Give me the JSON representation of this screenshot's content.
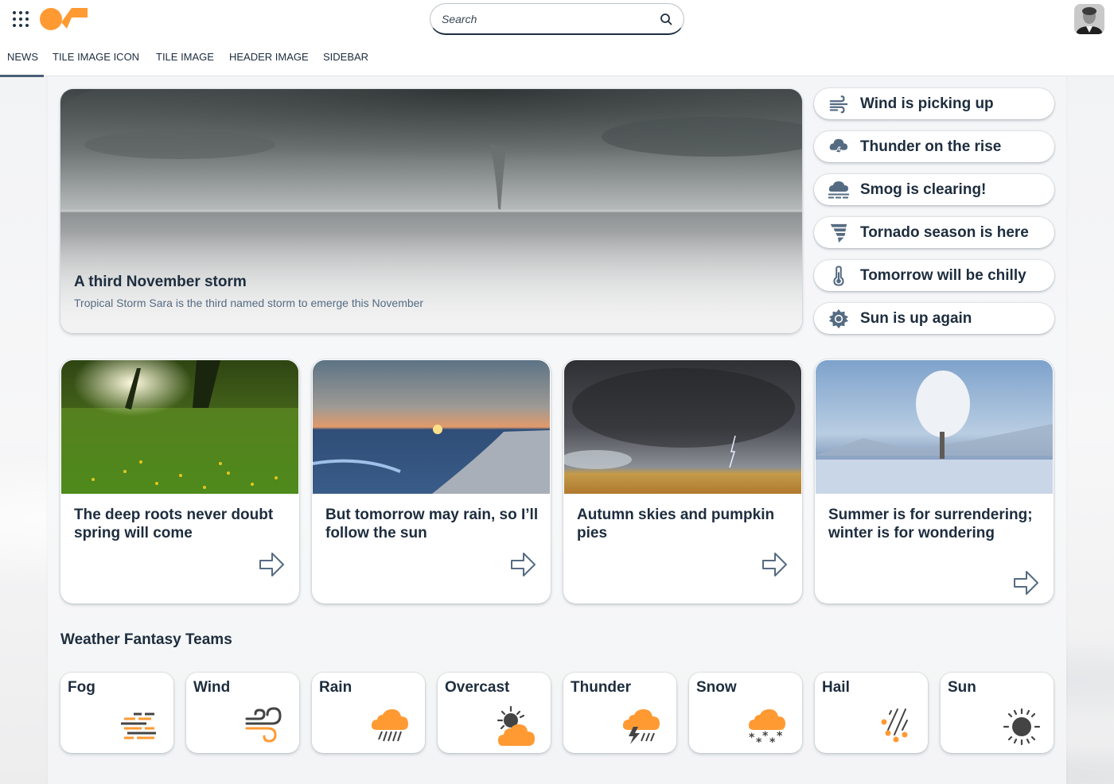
{
  "header": {
    "apps_icon": "grid-dots-icon",
    "logo": "brand-logo",
    "search": {
      "placeholder": "Search",
      "value": "",
      "icon": "search-icon"
    },
    "avatar": "user-avatar"
  },
  "tabs": [
    {
      "label": "NEWS",
      "active": true
    },
    {
      "label": "TILE IMAGE ICON",
      "active": false
    },
    {
      "label": "TILE IMAGE",
      "active": false
    },
    {
      "label": "HEADER IMAGE",
      "active": false
    },
    {
      "label": "SIDEBAR",
      "active": false
    }
  ],
  "hero": {
    "title": "A third November storm",
    "subtitle": "Tropical Storm Sara is the third named storm to emerge this November",
    "image": "tornado-over-sea"
  },
  "side_list": [
    {
      "label": "Wind is picking up",
      "icon": "wind-icon"
    },
    {
      "label": "Thunder on the rise",
      "icon": "thunder-cloud-icon"
    },
    {
      "label": "Smog is clearing!",
      "icon": "smog-icon"
    },
    {
      "label": "Tornado season is here",
      "icon": "tornado-icon"
    },
    {
      "label": "Tomorrow will be chilly",
      "icon": "thermometer-icon"
    },
    {
      "label": "Sun is up again",
      "icon": "sun-gear-icon"
    }
  ],
  "cards": [
    {
      "title": "The deep roots never doubt spring will come",
      "image": "spring-meadow",
      "action": "arrow-right-icon"
    },
    {
      "title": "But tomorrow may rain, so I’ll follow the sun",
      "image": "beach-sunset",
      "action": "arrow-right-icon"
    },
    {
      "title": "Autumn skies and pumpkin pies",
      "image": "storm-over-field",
      "action": "arrow-right-icon"
    },
    {
      "title": "Summer is for surrendering; winter is for wondering",
      "image": "frosted-tree",
      "action": "arrow-right-icon"
    }
  ],
  "teams_section": {
    "title": "Weather Fantasy Teams",
    "teams": [
      {
        "label": "Fog",
        "icon": "fog-icon"
      },
      {
        "label": "Wind",
        "icon": "wind-icon"
      },
      {
        "label": "Rain",
        "icon": "rain-icon"
      },
      {
        "label": "Overcast",
        "icon": "overcast-icon"
      },
      {
        "label": "Thunder",
        "icon": "thunderstorm-icon"
      },
      {
        "label": "Snow",
        "icon": "snow-icon"
      },
      {
        "label": "Hail",
        "icon": "hail-icon"
      },
      {
        "label": "Sun",
        "icon": "sun-icon"
      }
    ]
  },
  "colors": {
    "accent_orange": "#ff9a33",
    "icon_dark": "#444444",
    "text_primary": "#1d2d3e",
    "text_secondary": "#556b82",
    "icon_slate": "#556b82",
    "tab_indicator": "#475e75"
  }
}
